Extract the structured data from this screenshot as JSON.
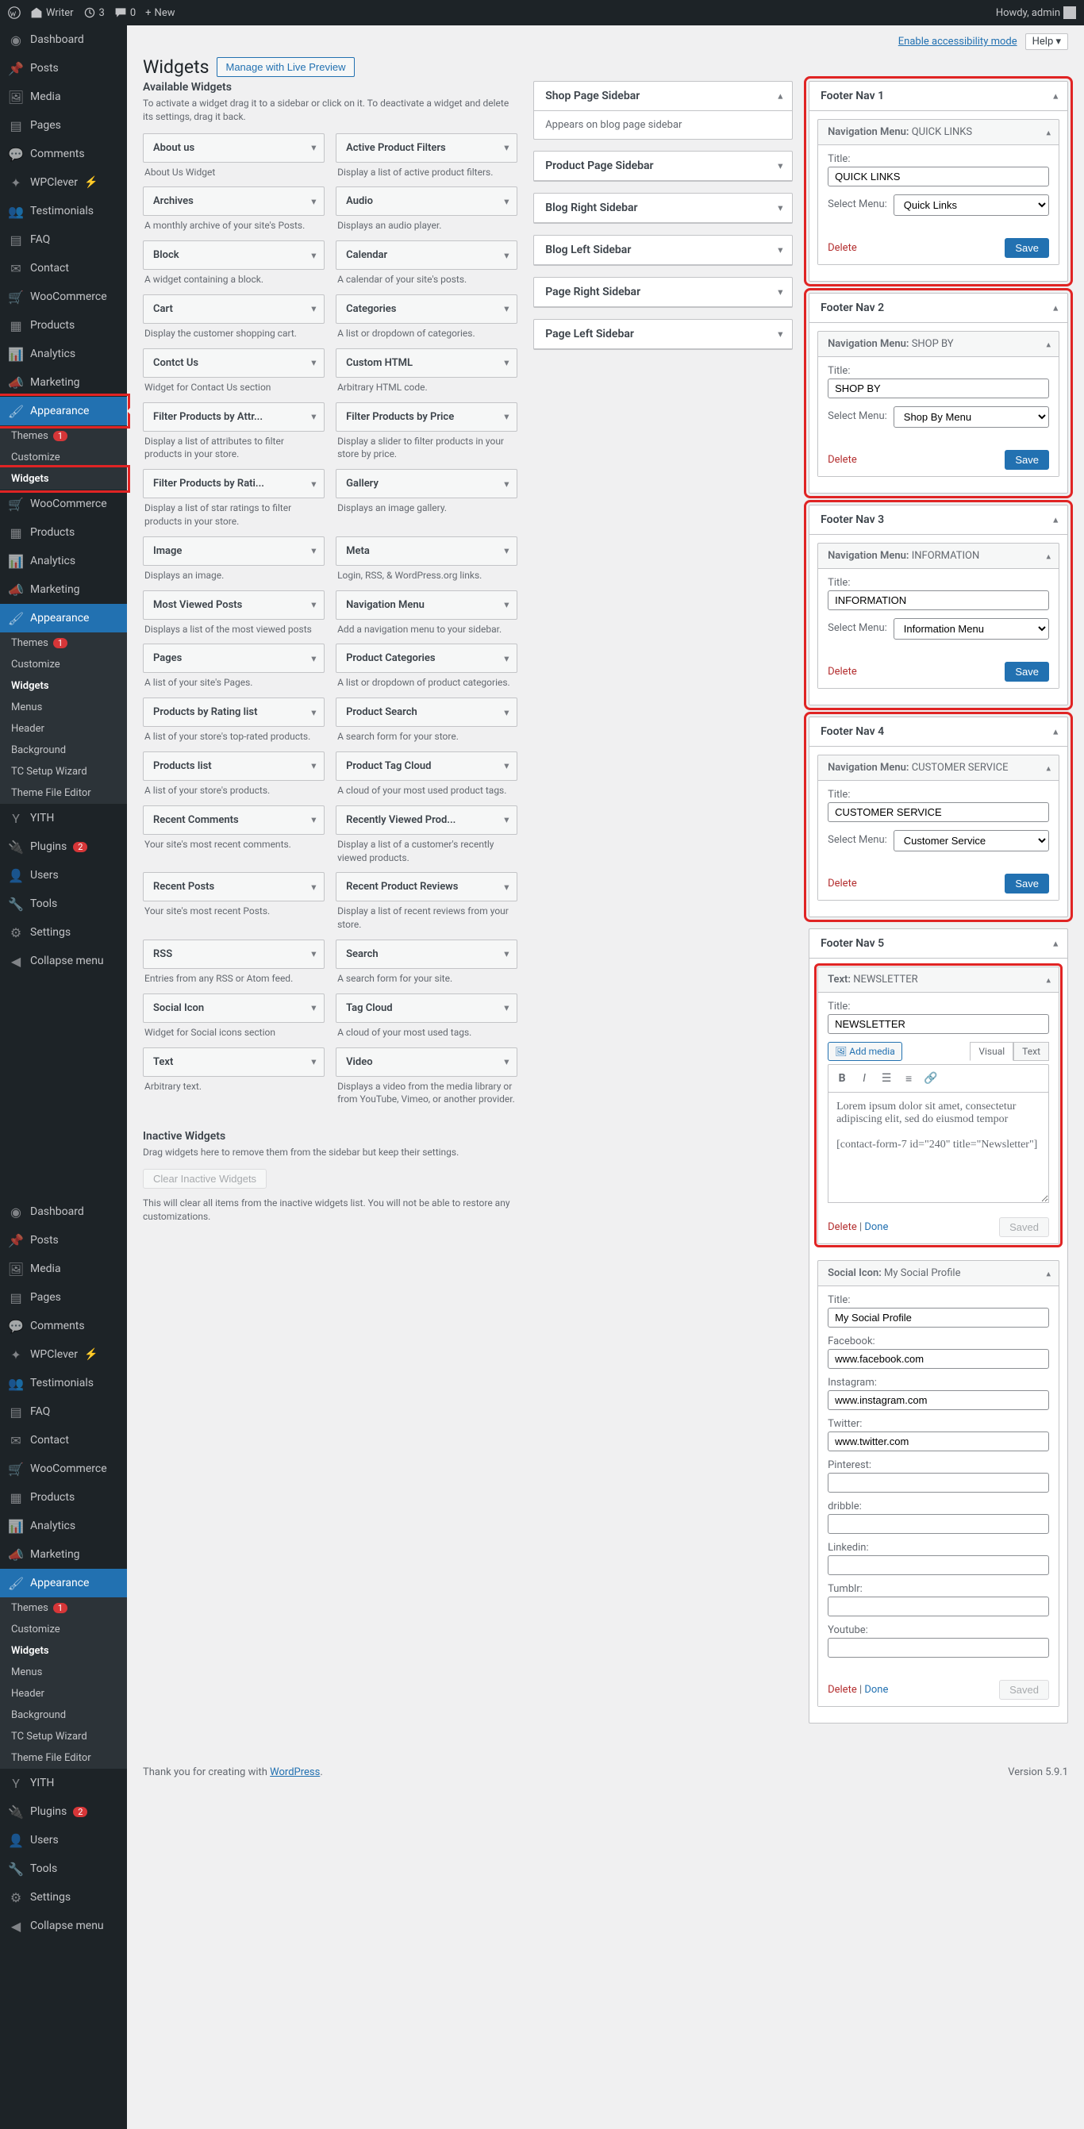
{
  "topbar": {
    "site": "Writer",
    "updates": "3",
    "comments": "0",
    "new": "New",
    "howdy": "Howdy, admin"
  },
  "toplinks": {
    "accessibility": "Enable accessibility mode",
    "help": "Help"
  },
  "page": {
    "title": "Widgets",
    "manage_btn": "Manage with Live Preview"
  },
  "menu": {
    "dashboard": "Dashboard",
    "posts": "Posts",
    "media": "Media",
    "pages": "Pages",
    "comments": "Comments",
    "wpclever": "WPClever",
    "testimonials": "Testimonials",
    "faq": "FAQ",
    "contact": "Contact",
    "woocommerce": "WooCommerce",
    "products": "Products",
    "analytics": "Analytics",
    "marketing": "Marketing",
    "appearance": "Appearance",
    "themes": "Themes",
    "themes_badge": "1",
    "customize": "Customize",
    "widgets": "Widgets",
    "menus": "Menus",
    "header": "Header",
    "background": "Background",
    "tcsetup": "TC Setup Wizard",
    "themeeditor": "Theme File Editor",
    "yith": "YITH",
    "plugins": "Plugins",
    "plugins_badge": "2",
    "users": "Users",
    "tools": "Tools",
    "settings": "Settings",
    "collapse": "Collapse menu"
  },
  "available": {
    "heading": "Available Widgets",
    "desc": "To activate a widget drag it to a sidebar or click on it. To deactivate a widget and delete its settings, drag it back.",
    "items": [
      {
        "t": "About us",
        "d": "About Us Widget"
      },
      {
        "t": "Active Product Filters",
        "d": "Display a list of active product filters."
      },
      {
        "t": "Archives",
        "d": "A monthly archive of your site's Posts."
      },
      {
        "t": "Audio",
        "d": "Displays an audio player."
      },
      {
        "t": "Block",
        "d": "A widget containing a block."
      },
      {
        "t": "Calendar",
        "d": "A calendar of your site's posts."
      },
      {
        "t": "Cart",
        "d": "Display the customer shopping cart."
      },
      {
        "t": "Categories",
        "d": "A list or dropdown of categories."
      },
      {
        "t": "Contct Us",
        "d": "Widget for Contact Us section"
      },
      {
        "t": "Custom HTML",
        "d": "Arbitrary HTML code."
      },
      {
        "t": "Filter Products by Attr...",
        "d": "Display a list of attributes to filter products in your store."
      },
      {
        "t": "Filter Products by Price",
        "d": "Display a slider to filter products in your store by price."
      },
      {
        "t": "Filter Products by Rati...",
        "d": "Display a list of star ratings to filter products in your store."
      },
      {
        "t": "Gallery",
        "d": "Displays an image gallery."
      },
      {
        "t": "Image",
        "d": "Displays an image."
      },
      {
        "t": "Meta",
        "d": "Login, RSS, & WordPress.org links."
      },
      {
        "t": "Most Viewed Posts",
        "d": "Displays a list of the most viewed posts"
      },
      {
        "t": "Navigation Menu",
        "d": "Add a navigation menu to your sidebar."
      },
      {
        "t": "Pages",
        "d": "A list of your site's Pages."
      },
      {
        "t": "Product Categories",
        "d": "A list or dropdown of product categories."
      },
      {
        "t": "Products by Rating list",
        "d": "A list of your store's top-rated products."
      },
      {
        "t": "Product Search",
        "d": "A search form for your store."
      },
      {
        "t": "Products list",
        "d": "A list of your store's products."
      },
      {
        "t": "Product Tag Cloud",
        "d": "A cloud of your most used product tags."
      },
      {
        "t": "Recent Comments",
        "d": "Your site's most recent comments."
      },
      {
        "t": "Recently Viewed Prod...",
        "d": "Display a list of a customer's recently viewed products."
      },
      {
        "t": "Recent Posts",
        "d": "Your site's most recent Posts."
      },
      {
        "t": "Recent Product Reviews",
        "d": "Display a list of recent reviews from your store."
      },
      {
        "t": "RSS",
        "d": "Entries from any RSS or Atom feed."
      },
      {
        "t": "Search",
        "d": "A search form for your site."
      },
      {
        "t": "Social Icon",
        "d": "Widget for Social icons section"
      },
      {
        "t": "Tag Cloud",
        "d": "A cloud of your most used tags."
      },
      {
        "t": "Text",
        "d": "Arbitrary text."
      },
      {
        "t": "Video",
        "d": "Displays a video from the media library or from YouTube, Vimeo, or another provider."
      }
    ]
  },
  "sidebars_mid": [
    {
      "t": "Shop Page Sidebar",
      "body": "Appears on blog page sidebar",
      "open": true
    },
    {
      "t": "Product Page Sidebar"
    },
    {
      "t": "Blog Right Sidebar"
    },
    {
      "t": "Blog Left Sidebar"
    },
    {
      "t": "Page Right Sidebar"
    },
    {
      "t": "Page Left Sidebar"
    }
  ],
  "footer_navs": [
    {
      "head": "Footer Nav 1",
      "w_label": "Navigation Menu:",
      "w_name": "QUICK LINKS",
      "title_label": "Title:",
      "title_val": "QUICK LINKS",
      "select_label": "Select Menu:",
      "select_val": "Quick Links",
      "del": "Delete",
      "save": "Save"
    },
    {
      "head": "Footer Nav 2",
      "w_label": "Navigation Menu:",
      "w_name": "SHOP BY",
      "title_label": "Title:",
      "title_val": "SHOP BY",
      "select_label": "Select Menu:",
      "select_val": "Shop By Menu",
      "del": "Delete",
      "save": "Save"
    },
    {
      "head": "Footer Nav 3",
      "w_label": "Navigation Menu:",
      "w_name": "INFORMATION",
      "title_label": "Title:",
      "title_val": "INFORMATION",
      "select_label": "Select Menu:",
      "select_val": "Information Menu",
      "del": "Delete",
      "save": "Save"
    },
    {
      "head": "Footer Nav 4",
      "w_label": "Navigation Menu:",
      "w_name": "CUSTOMER SERVICE",
      "title_label": "Title:",
      "title_val": "CUSTOMER SERVICE",
      "select_label": "Select Menu:",
      "select_val": "Customer Service",
      "del": "Delete",
      "save": "Save"
    }
  ],
  "footer5": {
    "head": "Footer Nav 5",
    "text_widget": {
      "label": "Text:",
      "name": "NEWSLETTER",
      "title_label": "Title:",
      "title_val": "NEWSLETTER",
      "add_media": "Add media",
      "visual": "Visual",
      "text_tab": "Text",
      "content": "Lorem ipsum dolor sit amet, consectetur adipiscing elit, sed do eiusmod tempor",
      "shortcode": "[contact-form-7 id=\"240\" title=\"Newsletter\"]",
      "del": "Delete",
      "sep": " | ",
      "done": "Done",
      "saved": "Saved"
    },
    "social": {
      "label": "Social Icon:",
      "name": "My Social Profile",
      "title_label": "Title:",
      "title_val": "My Social Profile",
      "fields": [
        {
          "l": "Facebook:",
          "v": "www.facebook.com"
        },
        {
          "l": "Instagram:",
          "v": "www.instagram.com"
        },
        {
          "l": "Twitter:",
          "v": "www.twitter.com"
        },
        {
          "l": "Pinterest:",
          "v": ""
        },
        {
          "l": "dribble:",
          "v": ""
        },
        {
          "l": "Linkedin:",
          "v": ""
        },
        {
          "l": "Tumblr:",
          "v": ""
        },
        {
          "l": "Youtube:",
          "v": ""
        }
      ],
      "del": "Delete",
      "sep": " | ",
      "done": "Done",
      "saved": "Saved"
    }
  },
  "inactive": {
    "heading": "Inactive Widgets",
    "desc": "Drag widgets here to remove them from the sidebar but keep their settings.",
    "btn": "Clear Inactive Widgets",
    "note": "This will clear all items from the inactive widgets list. You will not be able to restore any customizations."
  },
  "footer": {
    "thanks": "Thank you for creating with ",
    "wp": "WordPress",
    "dot": ".",
    "version": "Version 5.9.1"
  }
}
